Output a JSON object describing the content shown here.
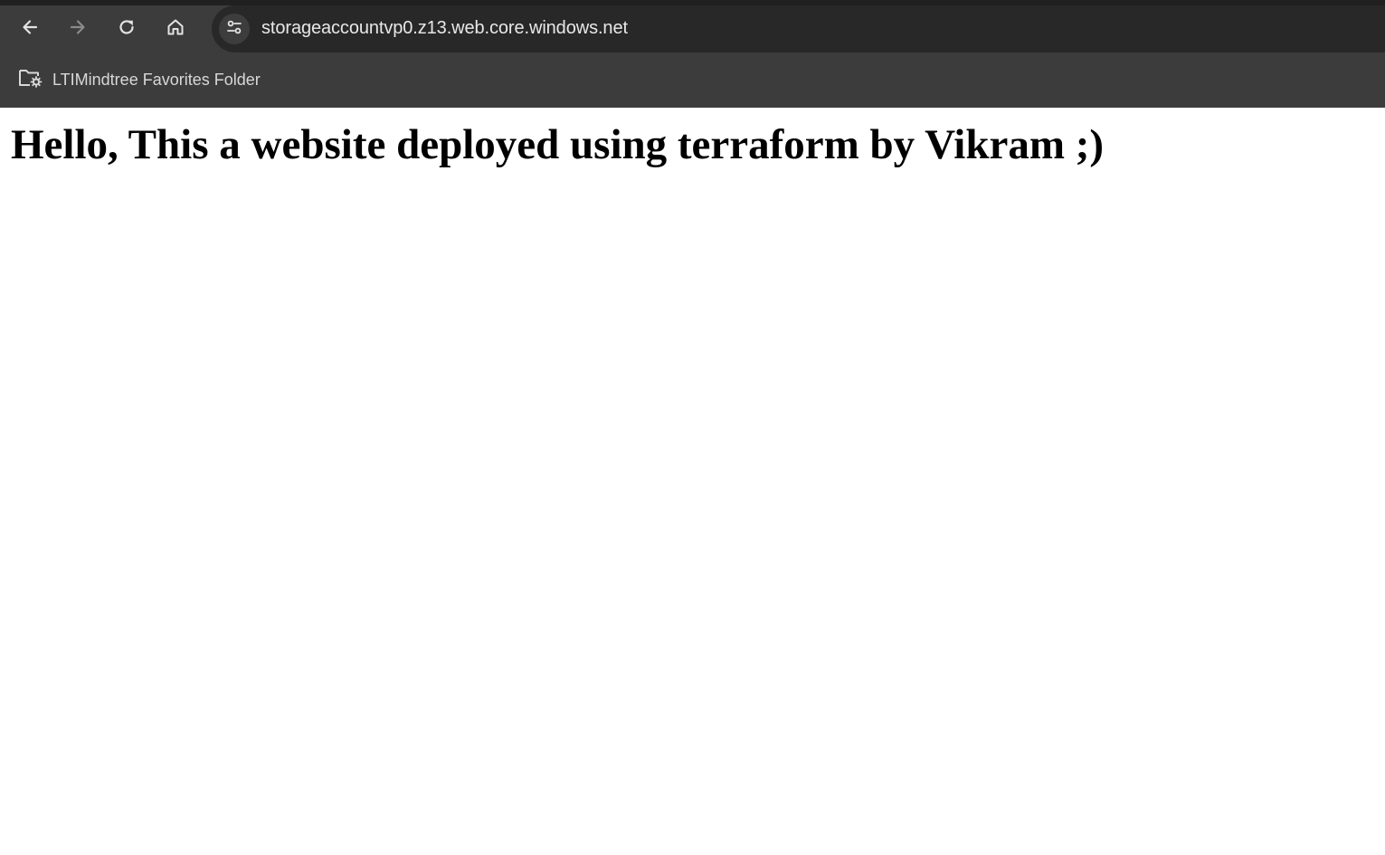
{
  "browser": {
    "url": "storageaccountvp0.z13.web.core.windows.net",
    "icons": {
      "back": "arrow-left-icon",
      "forward": "arrow-right-icon",
      "reload": "reload-icon",
      "home": "home-icon",
      "site_info": "tune-icon",
      "bookmark_folder": "managed-folder-icon"
    },
    "colors": {
      "chrome_bg": "#3c3c3c",
      "omnibox_bg": "#282828",
      "icon_active": "#e3e3e3",
      "icon_disabled": "#8a8a8a"
    }
  },
  "bookmarks": {
    "items": [
      {
        "label": "LTIMindtree Favorites Folder"
      }
    ]
  },
  "page": {
    "heading": "Hello, This a website deployed using terraform by Vikram ;)"
  }
}
